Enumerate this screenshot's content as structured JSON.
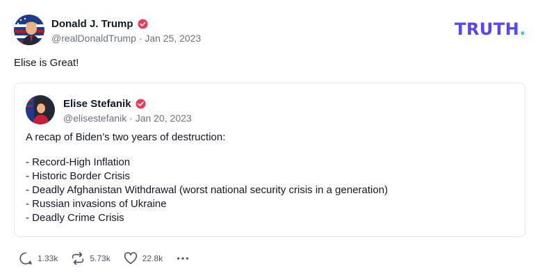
{
  "post": {
    "author": {
      "name": "Donald J. Trump",
      "handle": "@realDonaldTrump",
      "date": "Jan 25, 2023",
      "meta_separator": " · ",
      "avatar_icon": "flag-portrait-avatar"
    },
    "text": "Elise is Great!",
    "brand": {
      "word": "TRUTH",
      "dot": "."
    },
    "quote": {
      "author": {
        "name": "Elise Stefanik",
        "handle": "@elisestefanik",
        "date": "Jan 20, 2023",
        "meta_separator": " · ",
        "avatar_icon": "portrait-avatar"
      },
      "intro": "A recap of Biden’s two years of destruction:",
      "items": [
        "- Record-High Inflation",
        "- Historic Border Crisis",
        "- Deadly Afghanistan Withdrawal (worst national security crisis in a generation)",
        "- Russian invasions of Ukraine",
        "- Deadly Crime Crisis"
      ]
    },
    "actions": {
      "replies": "1.33k",
      "retruths": "5.73k",
      "likes": "22.8k"
    }
  },
  "colors": {
    "brand": "#5448ee",
    "brand_dot": "#2dd4bf",
    "verified": "#e63e5a",
    "muted_text": "#6b7280"
  }
}
